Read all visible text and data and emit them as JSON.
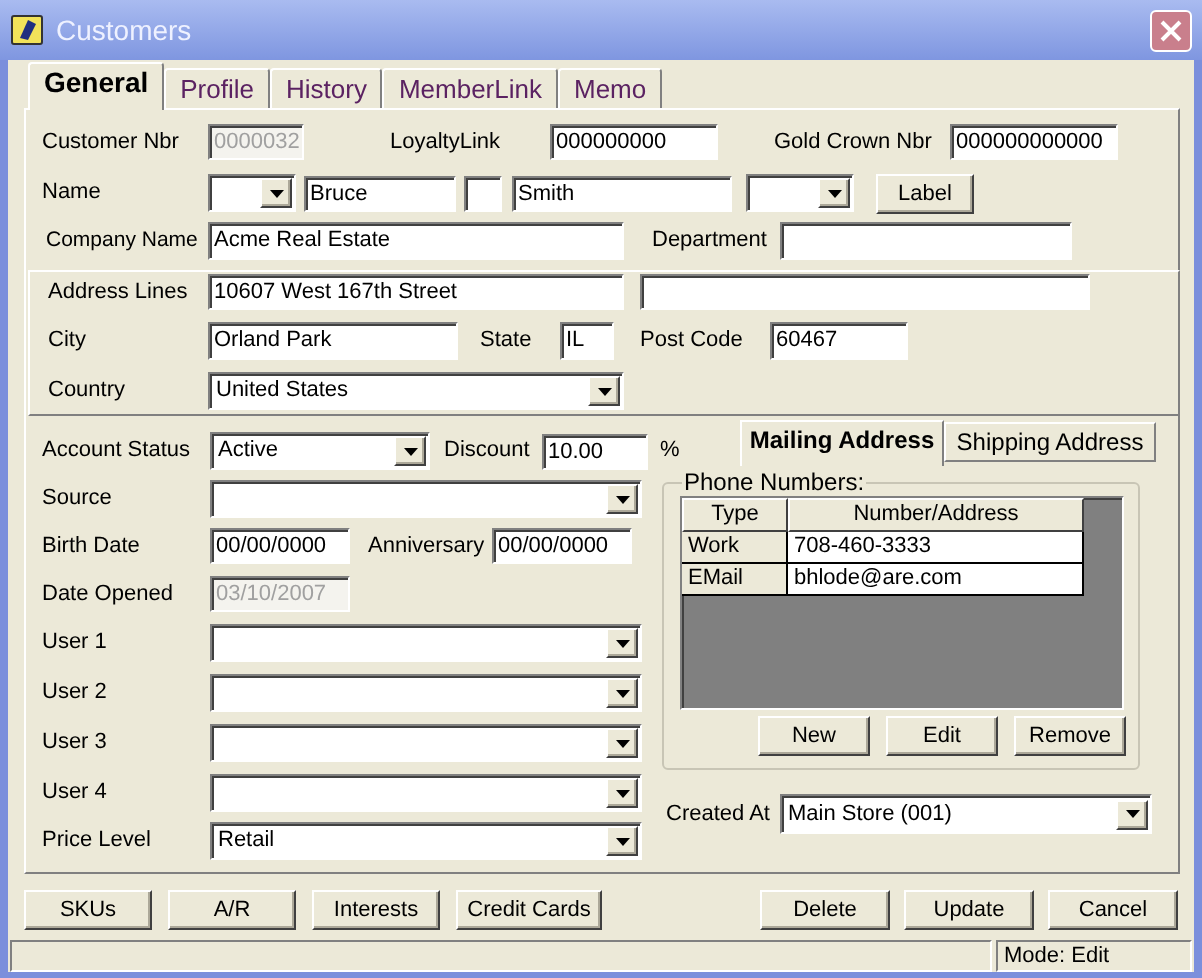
{
  "window": {
    "title": "Customers"
  },
  "tabs": [
    {
      "label": "General",
      "selected": true
    },
    {
      "label": "Profile",
      "selected": false
    },
    {
      "label": "History",
      "selected": false
    },
    {
      "label": "MemberLink",
      "selected": false
    },
    {
      "label": "Memo",
      "selected": false
    }
  ],
  "general": {
    "customer_nbr": {
      "label": "Customer Nbr",
      "value": "0000032",
      "disabled": true
    },
    "loyalty_link": {
      "label": "LoyaltyLink",
      "value": "000000000"
    },
    "gold_crown_nbr": {
      "label": "Gold Crown Nbr",
      "value": "000000000000"
    },
    "name": {
      "label": "Name",
      "first": "Bruce",
      "last": "Smith",
      "button": "Label"
    },
    "company_name": {
      "label": "Company Name",
      "value": "Acme Real Estate"
    },
    "department": {
      "label": "Department"
    },
    "address_lines": {
      "label": "Address Lines",
      "line_1": "10607 West 167th Street"
    },
    "city": {
      "label": "City",
      "value": "Orland Park"
    },
    "state": {
      "label": "State",
      "value": "IL"
    },
    "post_code": {
      "label": "Post Code",
      "value": "60467"
    },
    "country": {
      "label": "Country",
      "value": "United States"
    },
    "account_status": {
      "label": "Account Status",
      "value": "Active"
    },
    "discount": {
      "label": "Discount",
      "value": "10.00",
      "unit": "%"
    },
    "address_tabs": [
      {
        "label": "Mailing Address",
        "selected": true
      },
      {
        "label": "Shipping Address",
        "selected": false
      }
    ],
    "source": {
      "label": "Source"
    },
    "birth_date": {
      "label": "Birth Date",
      "value": "00/00/0000"
    },
    "anniversary": {
      "label": "Anniversary",
      "value": "00/00/0000"
    },
    "date_opened": {
      "label": "Date Opened",
      "value": "03/10/2007",
      "disabled": true
    },
    "user_fields": [
      {
        "label": "User 1"
      },
      {
        "label": "User 2"
      },
      {
        "label": "User 3"
      },
      {
        "label": "User 4"
      }
    ],
    "price_level": {
      "label": "Price Level",
      "value": "Retail"
    },
    "phone_numbers": {
      "title": "Phone Numbers:",
      "columns": [
        "Type",
        "Number/Address"
      ],
      "rows": [
        [
          "Work",
          "708-460-3333"
        ],
        [
          "EMail",
          "bhlode@are.com"
        ]
      ],
      "buttons": [
        "New",
        "Edit",
        "Remove"
      ]
    },
    "created_at": {
      "label": "Created At",
      "value": "Main Store (001)"
    }
  },
  "buttons_left": [
    "SKUs",
    "A/R",
    "Interests",
    "Credit Cards"
  ],
  "buttons_right": [
    "Delete",
    "Update",
    "Cancel"
  ],
  "status_bar": {
    "mode": "Mode: Edit"
  }
}
